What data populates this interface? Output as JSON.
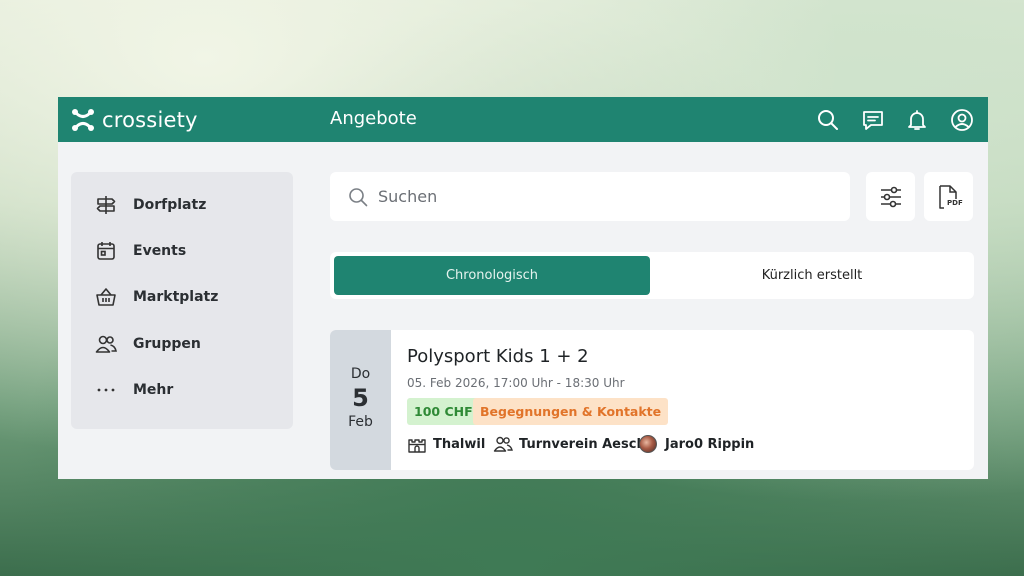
{
  "header": {
    "logo_text": "crossiety",
    "page_title": "Angebote",
    "icons": [
      "search-icon",
      "chat-icon",
      "bell-icon",
      "user-icon"
    ],
    "brand_color": "#1f8471"
  },
  "sidebar": {
    "items": [
      {
        "label": "Dorfplatz",
        "icon": "signpost-icon"
      },
      {
        "label": "Events",
        "icon": "calendar-icon"
      },
      {
        "label": "Marktplatz",
        "icon": "basket-icon"
      },
      {
        "label": "Gruppen",
        "icon": "group-icon"
      },
      {
        "label": "Mehr",
        "icon": "more-icon"
      }
    ]
  },
  "search": {
    "placeholder": "Suchen",
    "value": ""
  },
  "toolbar": {
    "filter_icon": "filter-sliders-icon",
    "pdf_icon": "pdf-file-icon",
    "pdf_label": "PDF"
  },
  "tabs": [
    {
      "label": "Chronologisch",
      "active": true
    },
    {
      "label": "Kürzlich erstellt",
      "active": false
    }
  ],
  "events": [
    {
      "weekday": "Do",
      "day": "5",
      "month": "Feb",
      "title": "Polysport Kids 1 + 2",
      "time": "05. Feb 2026, 17:00 Uhr - 18:30 Uhr",
      "price": "100 CHF",
      "category": "Begegnungen & Kontakte",
      "location": "Thalwil",
      "group": "Turnverein Aesch",
      "author": "Jaro0 Rippin"
    }
  ]
}
